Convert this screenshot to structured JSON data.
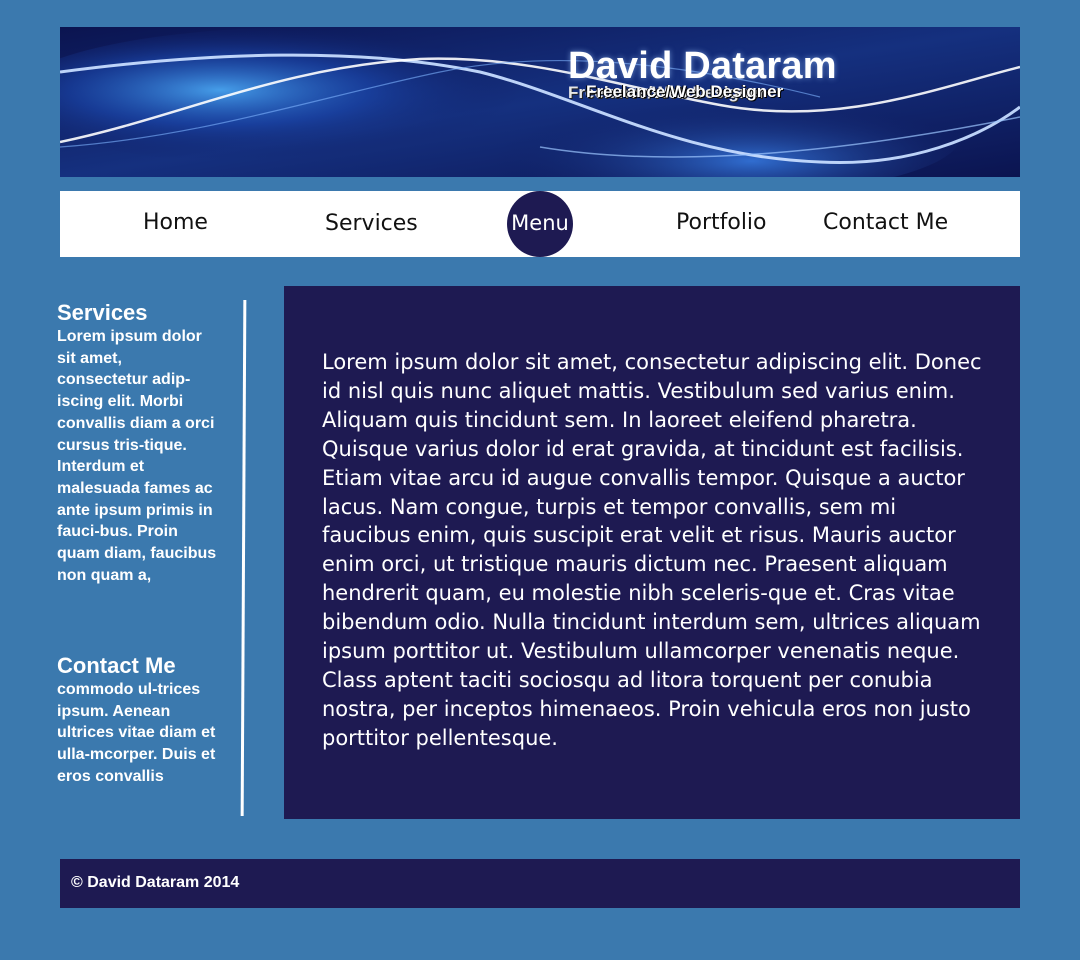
{
  "header": {
    "title": "David Dataram",
    "subtitle": "Freelance/Web Designer"
  },
  "nav": {
    "items": [
      "Home",
      "Services",
      "Menu",
      "Portfolio",
      "Contact Me"
    ]
  },
  "sidebar": {
    "services_heading": "Services",
    "services_text": "Lorem ipsum dolor sit amet, consectetur adip-iscing elit. Morbi convallis diam a orci cursus tris-tique. Interdum et malesuada fames ac ante ipsum primis in fauci-bus. Proin quam diam, faucibus non quam a,",
    "contact_heading": "Contact Me",
    "contact_text": "commodo ul-trices ipsum. Aenean ultrices vitae diam et ulla-mcorper. Duis et eros convallis"
  },
  "main": {
    "text": "Lorem ipsum dolor sit amet, consectetur adipiscing elit. Donec id nisl quis nunc aliquet mattis. Vestibulum sed varius enim. Aliquam quis tincidunt sem. In laoreet eleifend pharetra. Quisque varius dolor id erat gravida, at tincidunt est facilisis. Etiam vitae arcu id augue convallis tempor. Quisque a auctor lacus. Nam congue, turpis et tempor convallis, sem mi faucibus enim, quis suscipit erat velit et risus. Mauris auctor enim orci, ut tristique mauris dictum nec. Praesent aliquam hendrerit quam, eu molestie nibh sceleris-que et. Cras vitae bibendum odio. Nulla tincidunt interdum sem, ultrices aliquam ipsum porttitor ut. Vestibulum ullamcorper venenatis neque. Class aptent taciti sociosqu ad litora torquent per conubia nostra, per inceptos himenaeos. Proin vehicula eros non justo porttitor pellentesque."
  },
  "footer": {
    "copyright": "© David Dataram 2014"
  },
  "colors": {
    "page_background": "#3b79ae",
    "panel_navy": "#1e1a52",
    "banner_dark": "#0d1658",
    "nav_background": "#ffffff",
    "text_light": "#ffffff"
  }
}
